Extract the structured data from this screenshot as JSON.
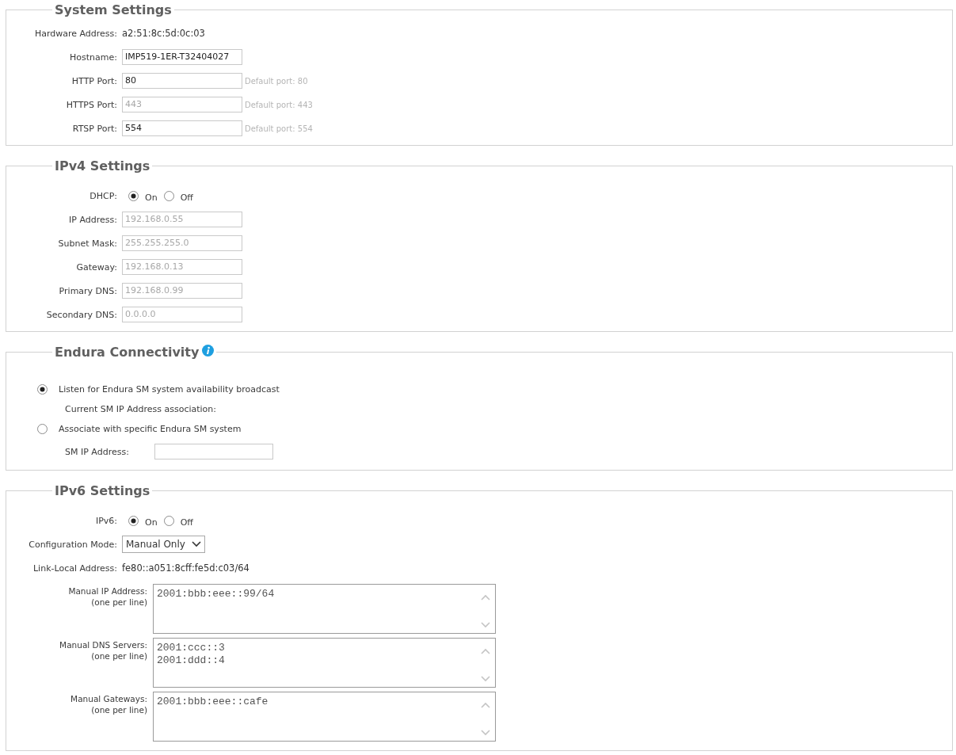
{
  "sections": [
    {
      "title": "System Settings",
      "info": false,
      "rows": [
        {
          "kind": "text",
          "label": "Hardware Address:",
          "value": "a2:51:8c:5d:0c:03"
        },
        {
          "kind": "input",
          "label": "Hostname:",
          "value": "IMP519-1ER-T32404027",
          "disabled": false
        },
        {
          "kind": "input",
          "label": "HTTP Port:",
          "value": "80",
          "disabled": false,
          "hint": "Default port: 80"
        },
        {
          "kind": "input",
          "label": "HTTPS Port:",
          "value": "443",
          "disabled": true,
          "hint": "Default port: 443"
        },
        {
          "kind": "input",
          "label": "RTSP Port:",
          "value": "554",
          "disabled": false,
          "hint": "Default port: 554"
        }
      ]
    },
    {
      "title": "IPv4 Settings",
      "info": false,
      "rows": [
        {
          "kind": "radio",
          "label": "DHCP:",
          "options": [
            {
              "label": "On",
              "selected": true
            },
            {
              "label": "Off",
              "selected": false
            }
          ]
        },
        {
          "kind": "input",
          "label": "IP Address:",
          "value": "192.168.0.55",
          "disabled": true
        },
        {
          "kind": "input",
          "label": "Subnet Mask:",
          "value": "255.255.255.0",
          "disabled": true
        },
        {
          "kind": "input",
          "label": "Gateway:",
          "value": "192.168.0.13",
          "disabled": true
        },
        {
          "kind": "input",
          "label": "Primary DNS:",
          "value": "192.168.0.99",
          "disabled": true
        },
        {
          "kind": "input",
          "label": "Secondary DNS:",
          "value": "0.0.0.0",
          "disabled": true
        }
      ]
    },
    {
      "title": "Endura Connectivity",
      "info": true,
      "rows": [
        {
          "kind": "option",
          "label": "Listen for Endura SM system availability broadcast",
          "selected": true
        },
        {
          "kind": "note",
          "text": "Current SM IP Address association:"
        },
        {
          "kind": "option",
          "label": "Associate with specific Endura SM system",
          "selected": false
        },
        {
          "kind": "inline-input",
          "label": "SM IP Address:"
        }
      ]
    },
    {
      "title": "IPv6 Settings",
      "info": false,
      "rows": [
        {
          "kind": "radio",
          "label": "IPv6:",
          "options": [
            {
              "label": "On",
              "selected": true
            },
            {
              "label": "Off",
              "selected": false
            }
          ]
        },
        {
          "kind": "select",
          "label": "Configuration Mode:",
          "value": "Manual Only"
        },
        {
          "kind": "text",
          "label": "Link-Local Address:",
          "value": "fe80::a051:8cff:fe5d:c03/64"
        },
        {
          "kind": "textarea",
          "label": "Manual IP Address:",
          "note": "(one per line)",
          "lines": [
            "2001:bbb:eee::99/64"
          ]
        },
        {
          "kind": "textarea",
          "label": "Manual DNS Servers:",
          "note": "(one per line)",
          "lines": [
            "2001:ccc::3",
            "2001:ddd::4"
          ]
        },
        {
          "kind": "textarea",
          "label": "Manual Gateways:",
          "note": "(one per line)",
          "lines": [
            "2001:bbb:eee::cafe"
          ]
        }
      ]
    }
  ]
}
